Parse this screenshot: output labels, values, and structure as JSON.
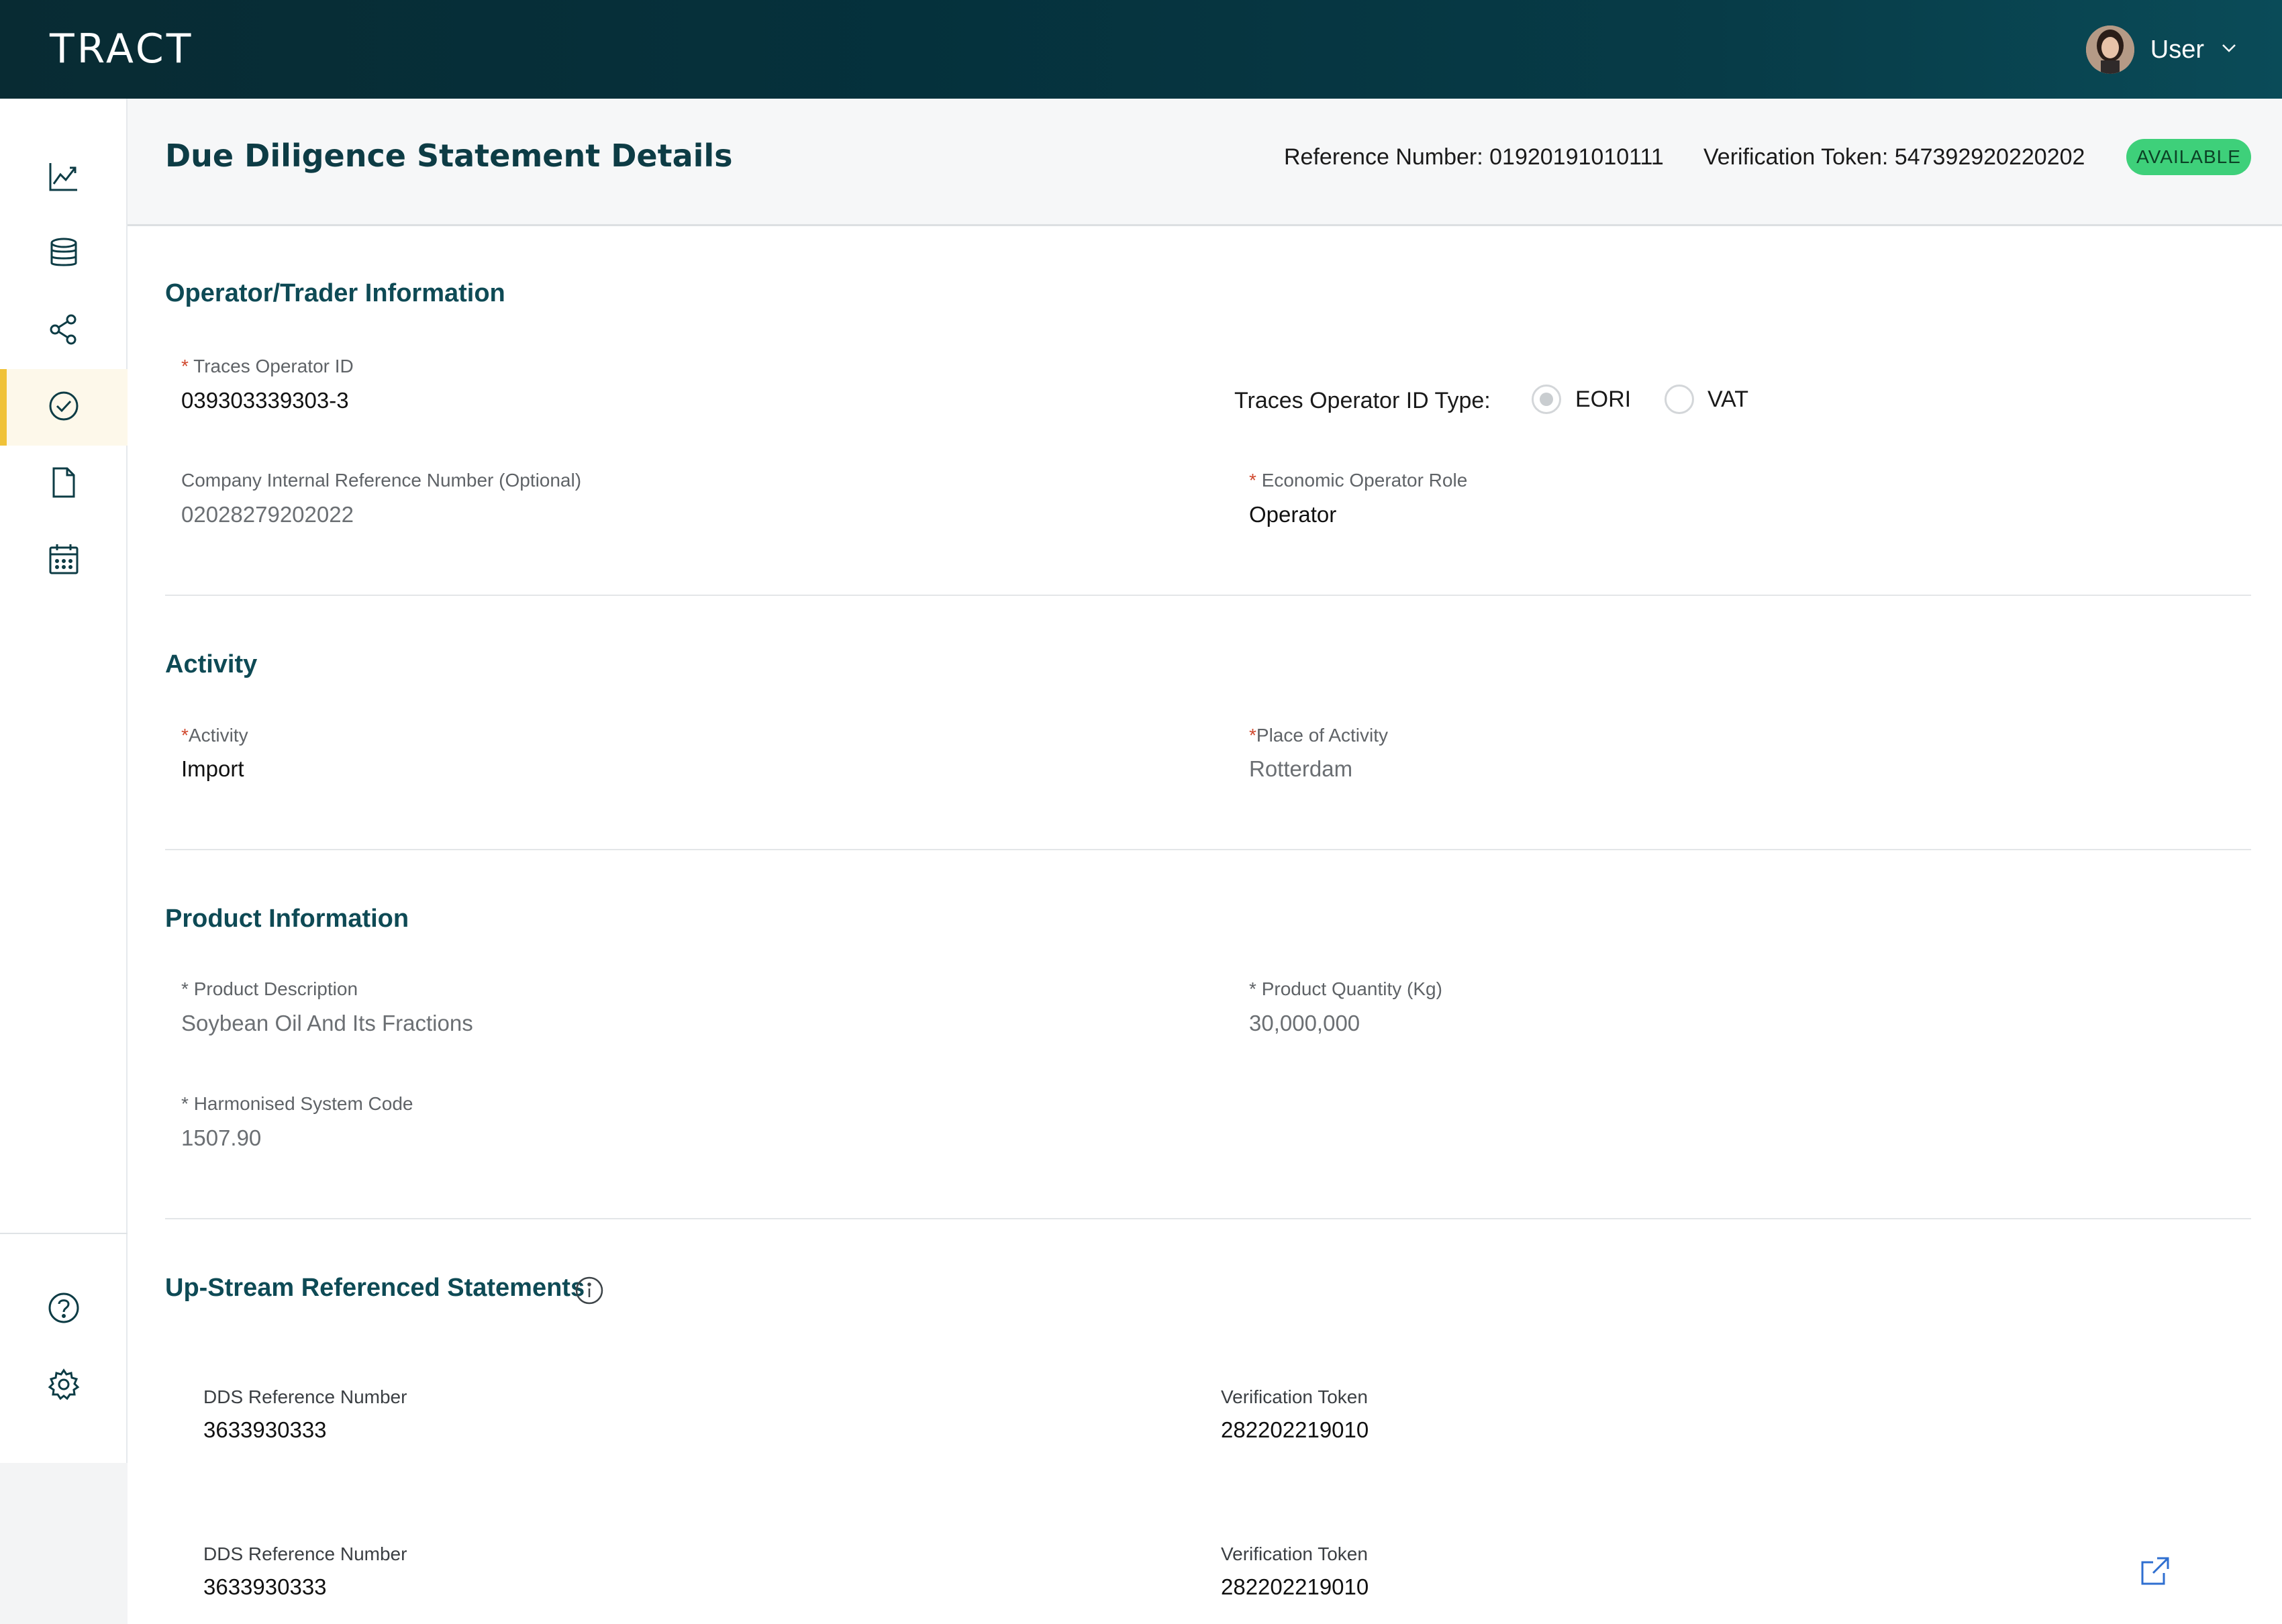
{
  "app": {
    "logo": "TRACT"
  },
  "user": {
    "name": "User",
    "avatar": "avatar-photo"
  },
  "sidebar": {
    "items": [
      {
        "name": "analytics",
        "icon": "chart-line-icon"
      },
      {
        "name": "database",
        "icon": "database-icon"
      },
      {
        "name": "network",
        "icon": "share-icon"
      },
      {
        "name": "due-diligence",
        "icon": "check-circle-icon",
        "active": true
      },
      {
        "name": "documents",
        "icon": "document-icon"
      },
      {
        "name": "calendar",
        "icon": "calendar-icon"
      }
    ],
    "bottom": [
      {
        "name": "help",
        "icon": "help-circle-icon"
      },
      {
        "name": "settings",
        "icon": "gear-icon"
      }
    ]
  },
  "header": {
    "title": "Due Diligence Statement Details",
    "reference_label": "Reference Number:",
    "reference_value": "01920191010111",
    "token_label": "Verification Token:",
    "token_value": "547392920220202",
    "status": "AVAILABLE",
    "status_color": "#3ed07a"
  },
  "operator": {
    "title": "Operator/Trader Information",
    "traces_id_label": "Traces Operator ID",
    "traces_id_value": "039303339303-3",
    "id_type_label": "Traces Operator ID Type:",
    "id_type_options": [
      "EORI",
      "VAT"
    ],
    "id_type_selected": "EORI",
    "company_ref_label": "Company Internal Reference Number (Optional)",
    "company_ref_value": "02028279202022",
    "role_label": "Economic Operator Role",
    "role_value": "Operator"
  },
  "activity": {
    "title": "Activity",
    "activity_label": "Activity",
    "activity_value": "Import",
    "place_label": "Place of Activity",
    "place_value": "Rotterdam"
  },
  "product": {
    "title": "Product Information",
    "description_label": "Product Description",
    "description_value": "Soybean Oil And Its Fractions",
    "quantity_label": "Product Quantity (Kg)",
    "quantity_value": "30,000,000",
    "hs_label": "Harmonised System Code",
    "hs_value": "1507.90"
  },
  "upstream": {
    "title": "Up-Stream Referenced Statements",
    "rows": [
      {
        "dds_label": "DDS Reference Number",
        "dds_value": "3633930333",
        "token_label": "Verification Token",
        "token_value": "282202219010"
      },
      {
        "dds_label": "DDS Reference Number",
        "dds_value": "3633930333",
        "token_label": "Verification Token",
        "token_value": "282202219010"
      }
    ]
  },
  "colors": {
    "accent": "#0e4a55",
    "active": "#f0c238",
    "required": "#d0492f",
    "link": "#2f6fd0"
  }
}
